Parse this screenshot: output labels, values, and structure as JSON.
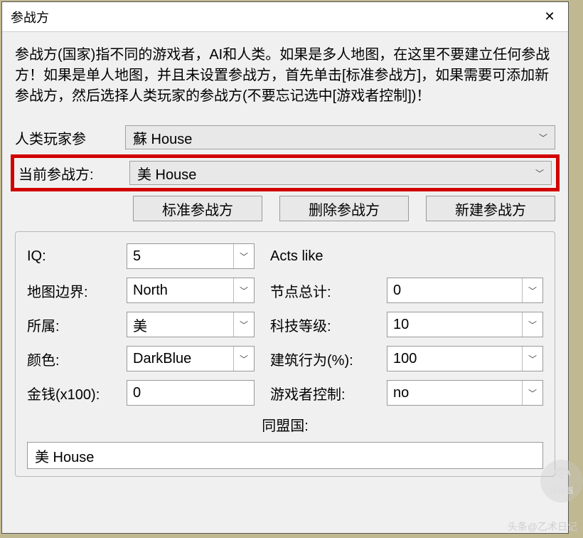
{
  "window": {
    "title": "参战方",
    "close_glyph": "✕"
  },
  "description": "参战方(国家)指不同的游戏者，AI和人类。如果是多人地图，在这里不要建立任何参战方！如果是单人地图，并且未设置参战方，首先单击[标准参战方]，如果需要可添加新参战方，然后选择人类玩家的参战方(不要忘记选中[游戏者控制])！",
  "fields": {
    "human_player_label": "人类玩家参",
    "human_player_value": "蘇 House",
    "current_side_label": "当前参战方:",
    "current_side_value": "美 House"
  },
  "buttons": {
    "standard": "标准参战方",
    "delete": "删除参战方",
    "new": "新建参战方"
  },
  "props": {
    "iq_label": "IQ:",
    "iq_value": "5",
    "actslike_label": "Acts like",
    "border_label": "地图边界:",
    "border_value": "North",
    "nodes_label": "节点总计:",
    "nodes_value": "0",
    "owner_label": "所属:",
    "owner_value": "美",
    "tech_label": "科技等级:",
    "tech_value": "10",
    "color_label": "颜色:",
    "color_value": "DarkBlue",
    "build_label": "建筑行为(%):",
    "build_value": "100",
    "money_label": "金钱(x100):",
    "money_value": "0",
    "playerctrl_label": "游戏者控制:",
    "playerctrl_value": "no",
    "ally_label": "同盟国:",
    "ally_value": "美 House"
  },
  "watermark": "头条@乙术日记",
  "router": "路由器"
}
